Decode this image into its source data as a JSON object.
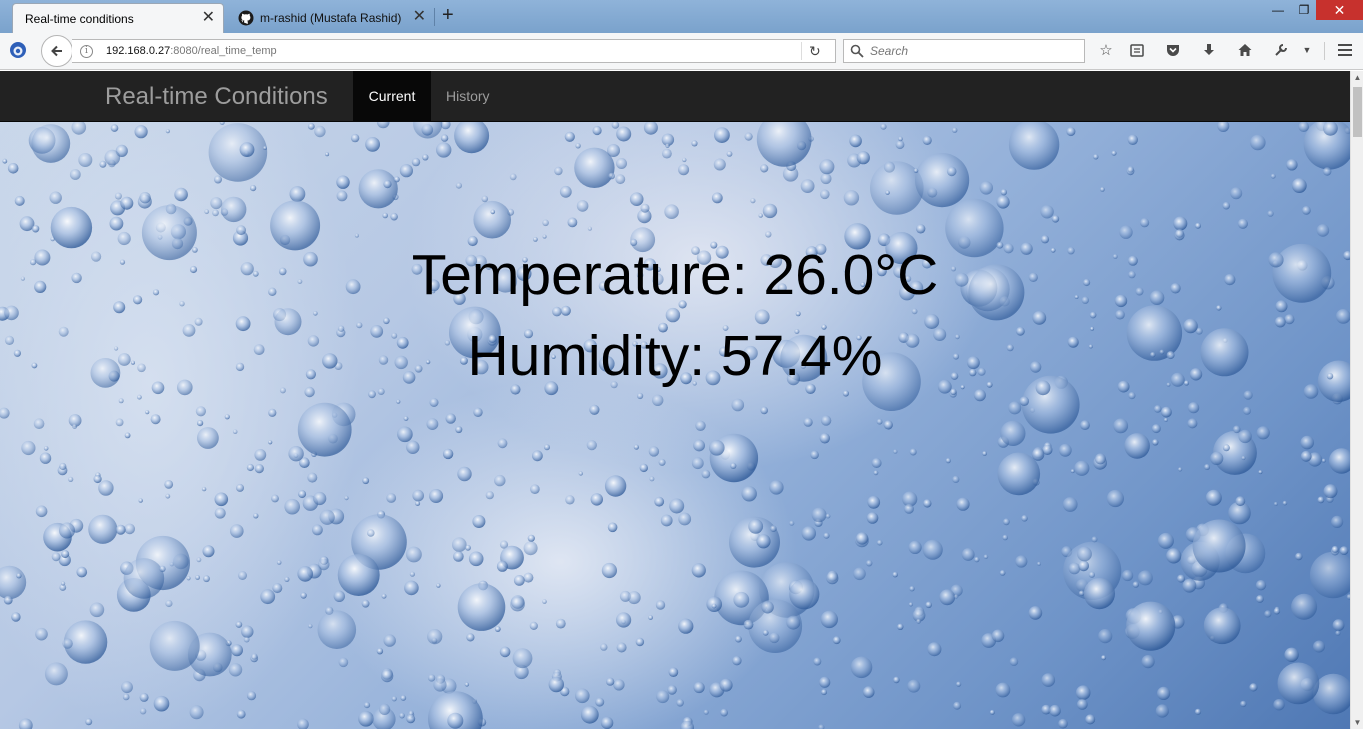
{
  "browser": {
    "tabs": [
      {
        "title": "Real-time conditions",
        "active": true
      },
      {
        "title": "m-rashid (Mustafa Rashid)",
        "active": false,
        "icon": "github-icon"
      }
    ],
    "address": {
      "host": "192.168.0.27",
      "path": ":8080/real_time_temp"
    },
    "search_placeholder": "Search"
  },
  "navbar": {
    "brand": "Real-time Conditions",
    "links": [
      {
        "label": "Current",
        "active": true
      },
      {
        "label": "History",
        "active": false
      }
    ]
  },
  "readings": {
    "temperature": "Temperature: 26.0°C",
    "humidity": "Humidity: 57.4%"
  },
  "colors": {
    "navbar_bg": "#222222",
    "navbar_active_bg": "#080808",
    "window_close": "#c7312d"
  }
}
